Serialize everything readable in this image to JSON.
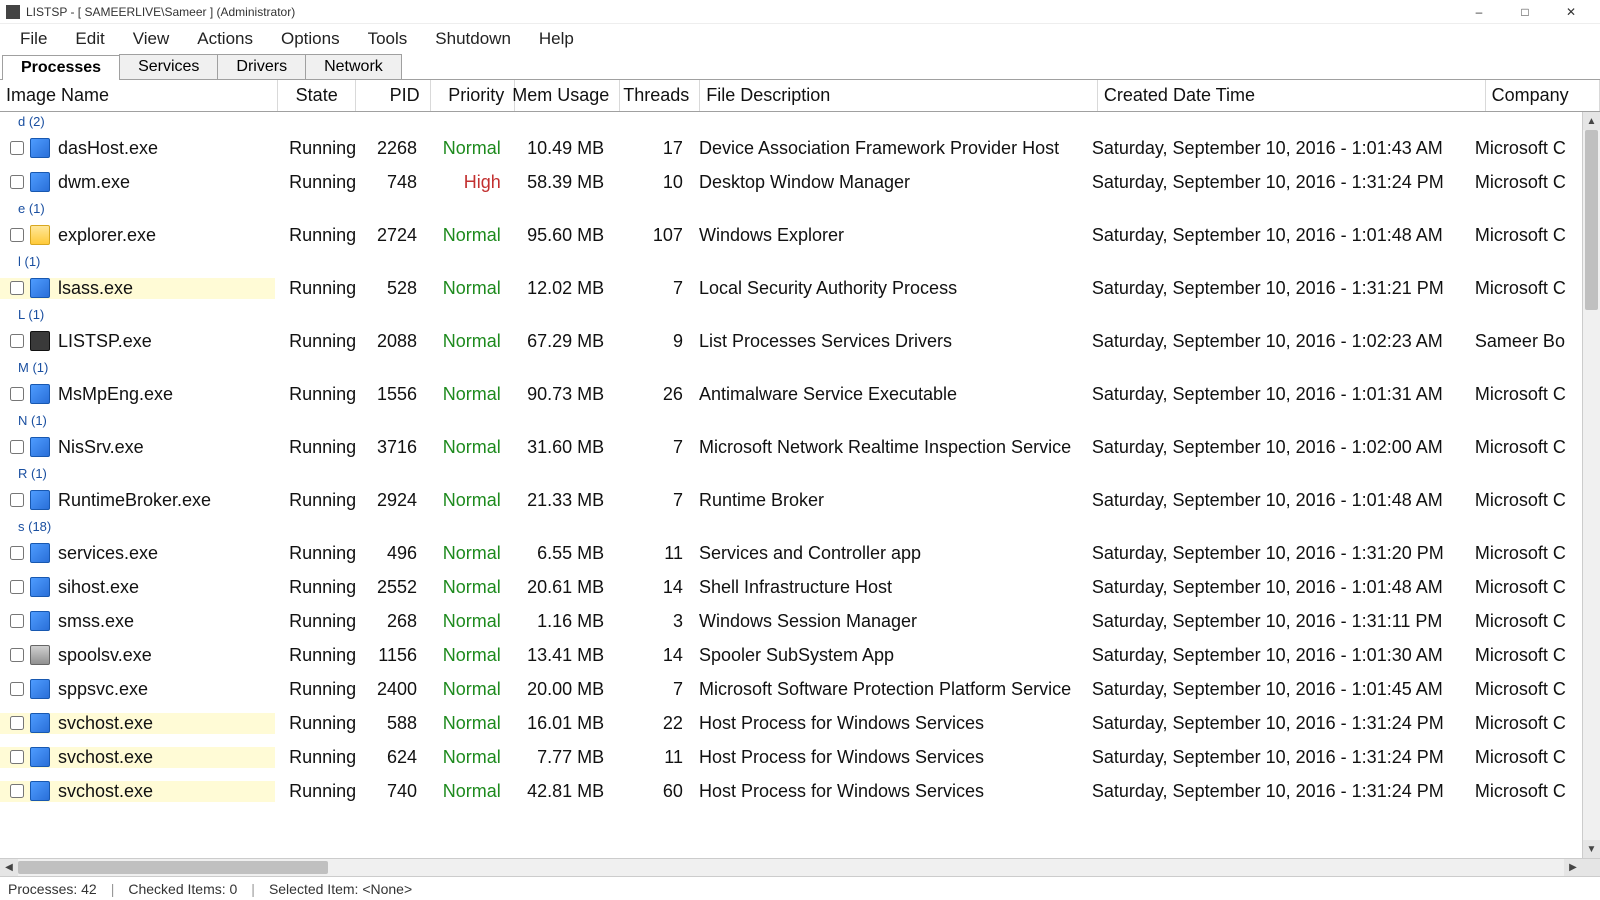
{
  "title": "LISTSP - [ SAMEERLIVE\\Sameer ] (Administrator)",
  "menu": [
    "File",
    "Edit",
    "View",
    "Actions",
    "Options",
    "Tools",
    "Shutdown",
    "Help"
  ],
  "tabs": [
    "Processes",
    "Services",
    "Drivers",
    "Network"
  ],
  "active_tab": 0,
  "columns": [
    "Image Name",
    "State",
    "PID",
    "Priority",
    "Mem Usage",
    "Threads",
    "File Description",
    "Created Date Time",
    "Company"
  ],
  "groups": [
    {
      "label": "d (2)",
      "rows": [
        {
          "icon": "blue",
          "name": "dasHost.exe",
          "state": "Running",
          "pid": "2268",
          "priority": "Normal",
          "mem": "10.49 MB",
          "threads": "17",
          "desc": "Device Association Framework Provider Host",
          "created": "Saturday, September 10, 2016 - 1:01:43 AM",
          "company": "Microsoft C",
          "hl": false
        },
        {
          "icon": "blue",
          "name": "dwm.exe",
          "state": "Running",
          "pid": "748",
          "priority": "High",
          "mem": "58.39 MB",
          "threads": "10",
          "desc": "Desktop Window Manager",
          "created": "Saturday, September 10, 2016 - 1:31:24 PM",
          "company": "Microsoft C",
          "hl": false
        }
      ]
    },
    {
      "label": "e (1)",
      "rows": [
        {
          "icon": "folder",
          "name": "explorer.exe",
          "state": "Running",
          "pid": "2724",
          "priority": "Normal",
          "mem": "95.60 MB",
          "threads": "107",
          "desc": "Windows Explorer",
          "created": "Saturday, September 10, 2016 - 1:01:48 AM",
          "company": "Microsoft C",
          "hl": false
        }
      ]
    },
    {
      "label": "l (1)",
      "rows": [
        {
          "icon": "blue",
          "name": "lsass.exe",
          "state": "Running",
          "pid": "528",
          "priority": "Normal",
          "mem": "12.02 MB",
          "threads": "7",
          "desc": "Local Security Authority Process",
          "created": "Saturday, September 10, 2016 - 1:31:21 PM",
          "company": "Microsoft C",
          "hl": true
        }
      ]
    },
    {
      "label": "L (1)",
      "rows": [
        {
          "icon": "dark",
          "name": "LISTSP.exe",
          "state": "Running",
          "pid": "2088",
          "priority": "Normal",
          "mem": "67.29 MB",
          "threads": "9",
          "desc": "List Processes Services Drivers",
          "created": "Saturday, September 10, 2016 - 1:02:23 AM",
          "company": "Sameer Bo",
          "hl": false
        }
      ]
    },
    {
      "label": "M (1)",
      "rows": [
        {
          "icon": "blue",
          "name": "MsMpEng.exe",
          "state": "Running",
          "pid": "1556",
          "priority": "Normal",
          "mem": "90.73 MB",
          "threads": "26",
          "desc": "Antimalware Service Executable",
          "created": "Saturday, September 10, 2016 - 1:01:31 AM",
          "company": "Microsoft C",
          "hl": false
        }
      ]
    },
    {
      "label": "N (1)",
      "rows": [
        {
          "icon": "blue",
          "name": "NisSrv.exe",
          "state": "Running",
          "pid": "3716",
          "priority": "Normal",
          "mem": "31.60 MB",
          "threads": "7",
          "desc": "Microsoft Network Realtime Inspection Service",
          "created": "Saturday, September 10, 2016 - 1:02:00 AM",
          "company": "Microsoft C",
          "hl": false
        }
      ]
    },
    {
      "label": "R (1)",
      "rows": [
        {
          "icon": "blue",
          "name": "RuntimeBroker.exe",
          "state": "Running",
          "pid": "2924",
          "priority": "Normal",
          "mem": "21.33 MB",
          "threads": "7",
          "desc": "Runtime Broker",
          "created": "Saturday, September 10, 2016 - 1:01:48 AM",
          "company": "Microsoft C",
          "hl": false
        }
      ]
    },
    {
      "label": "s (18)",
      "rows": [
        {
          "icon": "blue",
          "name": "services.exe",
          "state": "Running",
          "pid": "496",
          "priority": "Normal",
          "mem": "6.55 MB",
          "threads": "11",
          "desc": "Services and Controller app",
          "created": "Saturday, September 10, 2016 - 1:31:20 PM",
          "company": "Microsoft C",
          "hl": false
        },
        {
          "icon": "blue",
          "name": "sihost.exe",
          "state": "Running",
          "pid": "2552",
          "priority": "Normal",
          "mem": "20.61 MB",
          "threads": "14",
          "desc": "Shell Infrastructure Host",
          "created": "Saturday, September 10, 2016 - 1:01:48 AM",
          "company": "Microsoft C",
          "hl": false
        },
        {
          "icon": "blue",
          "name": "smss.exe",
          "state": "Running",
          "pid": "268",
          "priority": "Normal",
          "mem": "1.16 MB",
          "threads": "3",
          "desc": "Windows Session Manager",
          "created": "Saturday, September 10, 2016 - 1:31:11 PM",
          "company": "Microsoft C",
          "hl": false
        },
        {
          "icon": "printer",
          "name": "spoolsv.exe",
          "state": "Running",
          "pid": "1156",
          "priority": "Normal",
          "mem": "13.41 MB",
          "threads": "14",
          "desc": "Spooler SubSystem App",
          "created": "Saturday, September 10, 2016 - 1:01:30 AM",
          "company": "Microsoft C",
          "hl": false
        },
        {
          "icon": "blue",
          "name": "sppsvc.exe",
          "state": "Running",
          "pid": "2400",
          "priority": "Normal",
          "mem": "20.00 MB",
          "threads": "7",
          "desc": "Microsoft Software Protection Platform Service",
          "created": "Saturday, September 10, 2016 - 1:01:45 AM",
          "company": "Microsoft C",
          "hl": false
        },
        {
          "icon": "blue",
          "name": "svchost.exe",
          "state": "Running",
          "pid": "588",
          "priority": "Normal",
          "mem": "16.01 MB",
          "threads": "22",
          "desc": "Host Process for Windows Services",
          "created": "Saturday, September 10, 2016 - 1:31:24 PM",
          "company": "Microsoft C",
          "hl": true
        },
        {
          "icon": "blue",
          "name": "svchost.exe",
          "state": "Running",
          "pid": "624",
          "priority": "Normal",
          "mem": "7.77 MB",
          "threads": "11",
          "desc": "Host Process for Windows Services",
          "created": "Saturday, September 10, 2016 - 1:31:24 PM",
          "company": "Microsoft C",
          "hl": true
        },
        {
          "icon": "blue",
          "name": "svchost.exe",
          "state": "Running",
          "pid": "740",
          "priority": "Normal",
          "mem": "42.81 MB",
          "threads": "60",
          "desc": "Host Process for Windows Services",
          "created": "Saturday, September 10, 2016 - 1:31:24 PM",
          "company": "Microsoft C",
          "hl": true
        }
      ]
    }
  ],
  "status": {
    "processes": "Processes: 42",
    "checked": "Checked Items: 0",
    "selected": "Selected Item: <None>"
  }
}
